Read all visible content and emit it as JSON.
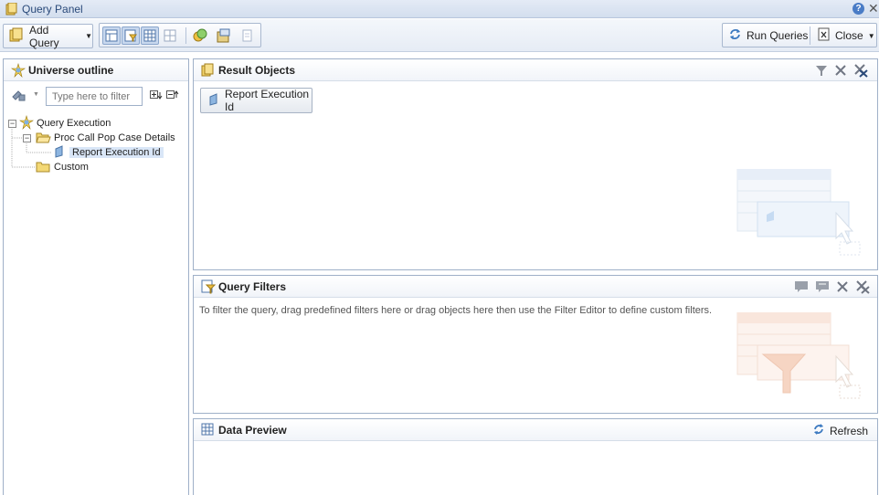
{
  "window": {
    "title": "Query Panel"
  },
  "toolbar": {
    "add_query_label": "Add Query",
    "run_queries_label": "Run Queries",
    "close_label": "Close"
  },
  "outline": {
    "title": "Universe outline",
    "filter_placeholder": "Type here to filter",
    "tree": {
      "root": "Query Execution",
      "folder1": "Proc Call Pop Case Details",
      "object1": "Report Execution Id",
      "folder2": "Custom"
    }
  },
  "result_objects": {
    "title": "Result Objects",
    "items": [
      "Report Execution Id"
    ]
  },
  "query_filters": {
    "title": "Query Filters",
    "hint": "To filter the query, drag predefined filters here or drag objects here then use the Filter Editor to define custom filters."
  },
  "data_preview": {
    "title": "Data Preview",
    "refresh_label": "Refresh"
  },
  "colors": {
    "accent": "#2a4a7a",
    "border": "#9fb0c8",
    "selection": "#d9e6f7"
  }
}
